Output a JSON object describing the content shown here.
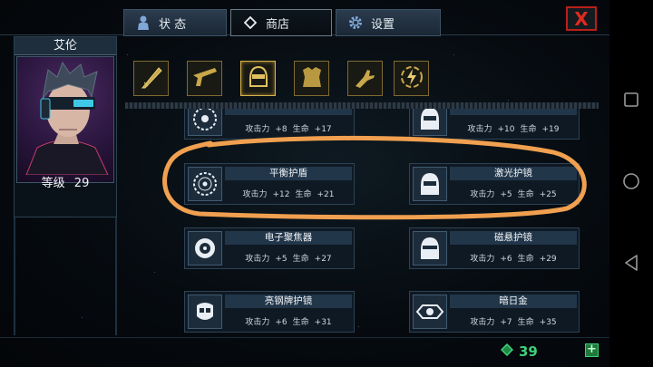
{
  "tabs": [
    {
      "label": "状 态",
      "icon": "person-icon"
    },
    {
      "label": "商店",
      "icon": "diamond-icon"
    },
    {
      "label": "设置",
      "icon": "gear-icon"
    }
  ],
  "close_label": "X",
  "character": {
    "name": "艾伦",
    "level_label": "等级",
    "level": "29"
  },
  "categories": [
    {
      "name": "blade-icon"
    },
    {
      "name": "gun-icon"
    },
    {
      "name": "helmet-icon",
      "selected": true
    },
    {
      "name": "armor-icon"
    },
    {
      "name": "glove-icon"
    },
    {
      "name": "energy-icon"
    }
  ],
  "items": [
    {
      "name": "",
      "attack_label": "攻击力",
      "attack": "+8",
      "hp_label": "生命",
      "hp": "+17",
      "icon": "disc-icon"
    },
    {
      "name": "",
      "attack_label": "攻击力",
      "attack": "+10",
      "hp_label": "生命",
      "hp": "+19",
      "icon": "helmet-icon"
    },
    {
      "name": "平衡护盾",
      "attack_label": "攻击力",
      "attack": "+12",
      "hp_label": "生命",
      "hp": "+21",
      "icon": "disc-icon"
    },
    {
      "name": "激光护镜",
      "attack_label": "攻击力",
      "attack": "+5",
      "hp_label": "生命",
      "hp": "+25",
      "icon": "helmet-icon"
    },
    {
      "name": "电子聚焦器",
      "attack_label": "攻击力",
      "attack": "+5",
      "hp_label": "生命",
      "hp": "+27",
      "icon": "lens-icon"
    },
    {
      "name": "磁悬护镜",
      "attack_label": "攻击力",
      "attack": "+6",
      "hp_label": "生命",
      "hp": "+29",
      "icon": "helmet-icon"
    },
    {
      "name": "亮钢牌护镜",
      "attack_label": "攻击力",
      "attack": "+6",
      "hp_label": "生命",
      "hp": "+31",
      "icon": "mask-icon"
    },
    {
      "name": "暗日金",
      "attack_label": "攻击力",
      "attack": "+7",
      "hp_label": "生命",
      "hp": "+35",
      "icon": "eye-icon"
    }
  ],
  "currency": {
    "amount": "39",
    "add_label": "+"
  },
  "colors": {
    "accent_gold": "#d6b24a",
    "currency_green": "#3fd07a",
    "annotation_orange": "#f0a050",
    "close_red": "#e02a20"
  }
}
